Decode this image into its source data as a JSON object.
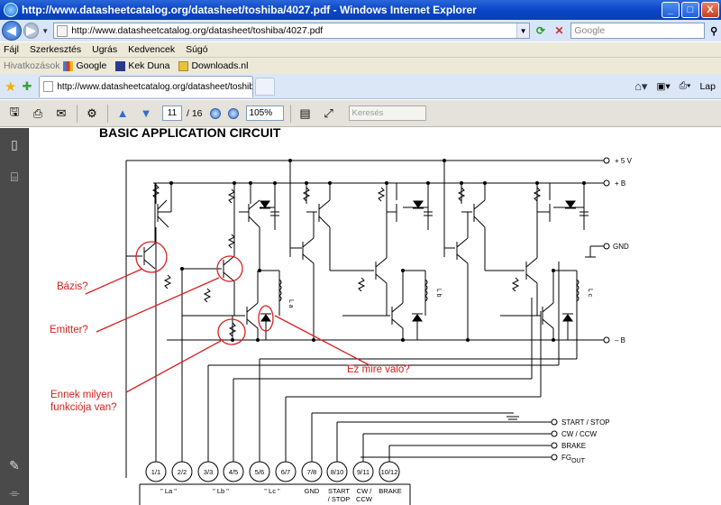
{
  "window": {
    "title": "http://www.datasheetcatalog.org/datasheet/toshiba/4027.pdf - Windows Internet Explorer",
    "min": "_",
    "max": "□",
    "close": "X"
  },
  "address": {
    "url": "http://www.datasheetcatalog.org/datasheet/toshiba/4027.pdf",
    "search_placeholder": "Google"
  },
  "menu": [
    "Fájl",
    "Szerkesztés",
    "Ugrás",
    "Kedvencek",
    "Súgó"
  ],
  "links": {
    "label": "Hivatkozások",
    "items": [
      "Google",
      "Kek Duna",
      "Downloads.nl"
    ]
  },
  "tab": {
    "title": "http://www.datasheetcatalog.org/datasheet/toshiba..."
  },
  "command_bar": {
    "page": "Lap"
  },
  "pdf_toolbar": {
    "page": "11",
    "total": "16",
    "zoom": "105%",
    "find_placeholder": "Keresés"
  },
  "document": {
    "heading": "BASIC APPLICATION CIRCUIT",
    "rails": {
      "v5": "+ 5 V",
      "pb": "+ B",
      "gnd": "GND",
      "mb": "– B"
    },
    "coils": [
      "L a",
      "L b",
      "L c"
    ],
    "signals": [
      "START / STOP",
      "CW / CCW",
      "BRAKE",
      "FG"
    ],
    "signal_sub": "OUT",
    "pins": [
      "1/1",
      "2/2",
      "3/3",
      "4/5",
      "5/6",
      "6/7",
      "7/8",
      "8/10",
      "9/11",
      "10/12"
    ],
    "pin_labels": [
      "\" La \"",
      "\" Lb \"",
      "\" Lc \"",
      "GND",
      "START",
      "/ STOP",
      "CW /",
      "CCW",
      "BRAKE"
    ]
  },
  "annotations": {
    "basis": "Bázis?",
    "emitter": "Emitter?",
    "function_l1": "Ennek milyen",
    "function_l2": "funkciója van?",
    "what_for": "Ez mire való?",
    "color": "#d82020"
  }
}
